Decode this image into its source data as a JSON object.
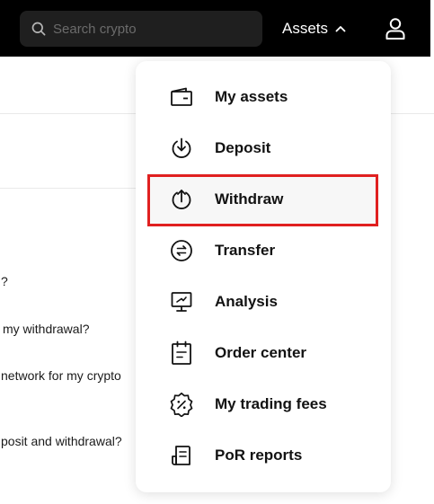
{
  "header": {
    "search_placeholder": "Search crypto",
    "assets_label": "Assets",
    "icons": {
      "search": "search-icon",
      "assets_toggle": "chevron-up-icon",
      "profile": "user-icon"
    }
  },
  "background": {
    "faq": [
      "?",
      "my withdrawal?",
      "network for my crypto",
      "posit and withdrawal?"
    ]
  },
  "menu": {
    "items": [
      {
        "label": "My assets",
        "icon": "wallet-icon"
      },
      {
        "label": "Deposit",
        "icon": "deposit-icon"
      },
      {
        "label": "Withdraw",
        "icon": "withdraw-icon"
      },
      {
        "label": "Transfer",
        "icon": "transfer-icon"
      },
      {
        "label": "Analysis",
        "icon": "analysis-icon"
      },
      {
        "label": "Order center",
        "icon": "order-center-icon"
      },
      {
        "label": "My trading fees",
        "icon": "trading-fees-icon"
      },
      {
        "label": "PoR reports",
        "icon": "por-reports-icon"
      }
    ],
    "highlighted_item": "Withdraw"
  },
  "colors": {
    "topbar": "#000000",
    "highlight_border": "#e02020",
    "text": "#121212"
  }
}
